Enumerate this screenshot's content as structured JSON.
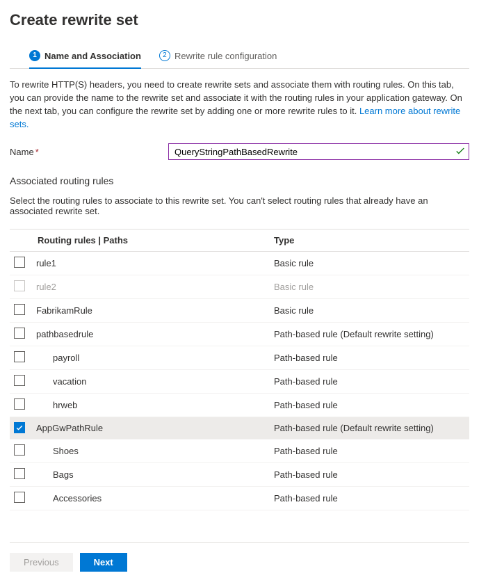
{
  "header": {
    "title": "Create rewrite set"
  },
  "tabs": [
    {
      "step": "1",
      "label": "Name and Association",
      "active": true
    },
    {
      "step": "2",
      "label": "Rewrite rule configuration",
      "active": false
    }
  ],
  "intro": {
    "text": "To rewrite HTTP(S) headers, you need to create rewrite sets and associate them with routing rules. On this tab, you can provide the name to the rewrite set and associate it with the routing rules in your application gateway. On the next tab, you can configure the rewrite set by adding one or more rewrite rules to it.  ",
    "link": "Learn more about rewrite sets."
  },
  "nameField": {
    "label": "Name",
    "required": "*",
    "value": "QueryStringPathBasedRewrite"
  },
  "assoc": {
    "title": "Associated routing rules",
    "sub": "Select the routing rules to associate to this rewrite set. You can't select routing rules that already have an associated rewrite set."
  },
  "table": {
    "col1": "Routing rules | Paths",
    "col2": "Type",
    "rows": [
      {
        "name": "rule1",
        "type": "Basic rule",
        "checked": false,
        "disabled": false,
        "indent": 0
      },
      {
        "name": "rule2",
        "type": "Basic rule",
        "checked": false,
        "disabled": true,
        "indent": 0
      },
      {
        "name": "FabrikamRule",
        "type": "Basic rule",
        "checked": false,
        "disabled": false,
        "indent": 0
      },
      {
        "name": "pathbasedrule",
        "type": "Path-based rule (Default rewrite setting)",
        "checked": false,
        "disabled": false,
        "indent": 0
      },
      {
        "name": "payroll",
        "type": "Path-based rule",
        "checked": false,
        "disabled": false,
        "indent": 1
      },
      {
        "name": "vacation",
        "type": "Path-based rule",
        "checked": false,
        "disabled": false,
        "indent": 1
      },
      {
        "name": "hrweb",
        "type": "Path-based rule",
        "checked": false,
        "disabled": false,
        "indent": 1
      },
      {
        "name": "AppGwPathRule",
        "type": "Path-based rule (Default rewrite setting)",
        "checked": true,
        "disabled": false,
        "indent": 0
      },
      {
        "name": "Shoes",
        "type": "Path-based rule",
        "checked": false,
        "disabled": false,
        "indent": 1
      },
      {
        "name": "Bags",
        "type": "Path-based rule",
        "checked": false,
        "disabled": false,
        "indent": 1
      },
      {
        "name": "Accessories",
        "type": "Path-based rule",
        "checked": false,
        "disabled": false,
        "indent": 1
      }
    ]
  },
  "footer": {
    "previous": "Previous",
    "next": "Next"
  }
}
